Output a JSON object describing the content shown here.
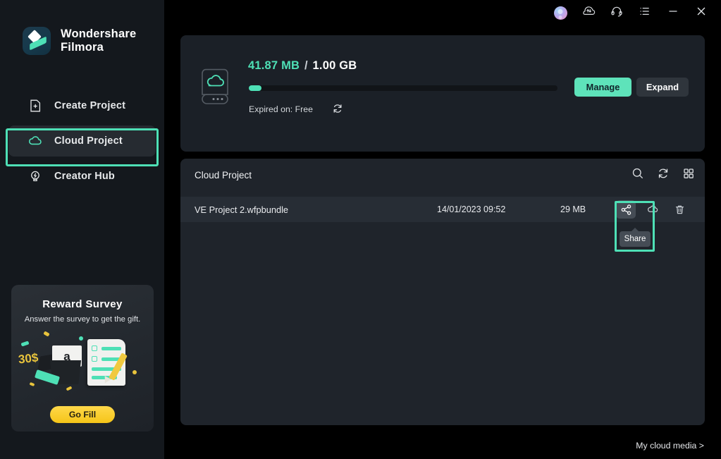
{
  "app": {
    "brand_line1": "Wondershare",
    "brand_line2": "Filmora"
  },
  "titlebar": {
    "buttons": [
      {
        "name": "account-avatar",
        "label": ""
      },
      {
        "name": "cloud-sync-icon",
        "label": ""
      },
      {
        "name": "headset-support-icon",
        "label": ""
      },
      {
        "name": "menu-list-icon",
        "label": ""
      },
      {
        "name": "minimize-button",
        "label": ""
      },
      {
        "name": "close-button",
        "label": ""
      }
    ]
  },
  "sidebar": {
    "items": [
      {
        "label": "Create Project",
        "icon": "new-document-icon",
        "active": false
      },
      {
        "label": "Cloud Project",
        "icon": "cloud-icon",
        "active": true
      },
      {
        "label": "Creator Hub",
        "icon": "lightbulb-icon",
        "active": false
      }
    ],
    "promo": {
      "title": "Reward Survey",
      "subtitle": "Answer the survey to get the gift.",
      "price_tag": "30$",
      "card_letter": "a",
      "button": "Go Fill"
    }
  },
  "storage": {
    "used": "41.87 MB",
    "separator": "/",
    "total": "1.00 GB",
    "progress_percent": 4,
    "expiry_label": "Expired on: Free",
    "refresh_icon": "refresh-icon",
    "manage_button": "Manage",
    "expand_button": "Expand",
    "drive_icon": "cloud-drive-icon",
    "accent_color": "#4ee0b6"
  },
  "list": {
    "title": "Cloud Project",
    "tools": [
      {
        "name": "search-icon"
      },
      {
        "name": "refresh-icon"
      },
      {
        "name": "grid-view-icon"
      }
    ],
    "rows": [
      {
        "name": "VE Project 2.wfpbundle",
        "date": "14/01/2023 09:52",
        "size": "29 MB",
        "actions": [
          {
            "name": "share-icon",
            "hovered": true
          },
          {
            "name": "cloud-download-icon",
            "hovered": false
          },
          {
            "name": "delete-icon",
            "hovered": false
          }
        ]
      }
    ]
  },
  "tooltip": {
    "text": "Share"
  },
  "footer": {
    "cloud_media_link": "My cloud media >"
  }
}
